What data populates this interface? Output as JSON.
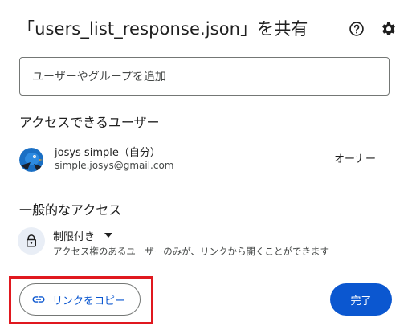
{
  "dialog": {
    "title": "「users_list_response.json」を共有",
    "help_icon": "help-circle-icon",
    "settings_icon": "gear-icon"
  },
  "add_people": {
    "placeholder": "ユーザーやグループを追加"
  },
  "people_with_access": {
    "heading": "アクセスできるユーザー",
    "users": [
      {
        "name": "josys simple（自分）",
        "email": "simple.josys@gmail.com",
        "role": "オーナー",
        "avatar_icon": "avatar-bird-icon"
      }
    ]
  },
  "general_access": {
    "heading": "一般的なアクセス",
    "selected": "制限付き",
    "description": "アクセス権のあるユーザーのみが、リンクから開くことができます",
    "icon": "lock-icon"
  },
  "footer": {
    "copy_link_label": "リンクをコピー",
    "copy_link_icon": "link-icon",
    "done_label": "完了"
  },
  "colors": {
    "accent": "#0b57d0",
    "highlight": "#e0181f",
    "lock_bg": "#e9eef6"
  }
}
